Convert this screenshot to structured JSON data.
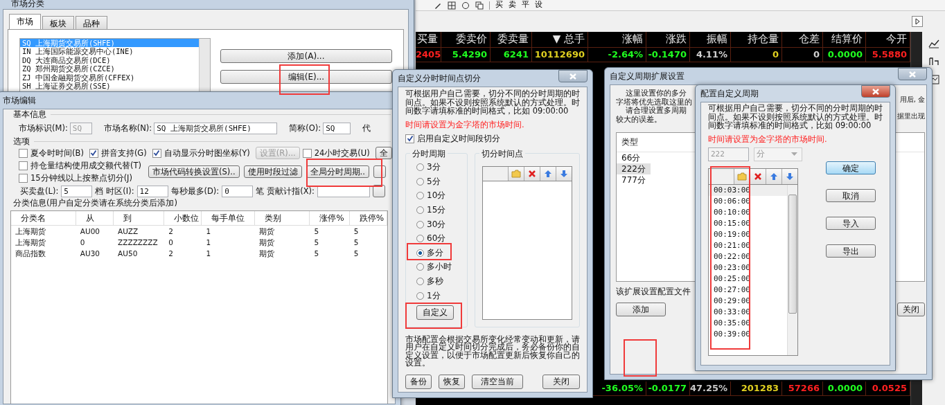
{
  "toolbar": {
    "buttons": [
      "买",
      "卖",
      "平",
      "设"
    ]
  },
  "quote_grid": {
    "columns": [
      "买量",
      "委卖价",
      "委卖量",
      "▼ 总手",
      "涨幅",
      "涨跌",
      "振幅",
      "持仓量",
      "仓差",
      "结算价",
      "今开"
    ],
    "rows": [
      {
        "cells": [
          {
            "text": "2405",
            "color": "#ff2020"
          },
          {
            "text": "5.4290",
            "color": "#20ff20"
          },
          {
            "text": "6241",
            "color": "#20ff20"
          },
          {
            "text": "10112690",
            "color": "#e0d020"
          },
          {
            "text": "-2.64%",
            "color": "#20ff20"
          },
          {
            "text": "-0.1470",
            "color": "#20ff20"
          },
          {
            "text": "4.11%",
            "color": "#d0d0d0"
          },
          {
            "text": "0",
            "color": "#e0d020"
          },
          {
            "text": "0",
            "color": "#d0d0d0"
          },
          {
            "text": "0.0000",
            "color": "#20ff20"
          },
          {
            "text": "5.5880",
            "color": "#ff2020"
          }
        ]
      },
      {
        "cells": [
          null,
          null,
          null,
          null,
          {
            "text": "-36.05%",
            "color": "#20ff20"
          },
          {
            "text": "-0.0177",
            "color": "#20ff20"
          },
          {
            "text": "47.25%",
            "color": "#c8c8c8"
          },
          {
            "text": "201283",
            "color": "#e0d020"
          },
          {
            "text": "57266",
            "color": "#ff2020"
          },
          {
            "text": "0.0000",
            "color": "#20ff20"
          },
          {
            "text": "0.0525",
            "color": "#ff2020"
          }
        ]
      }
    ]
  },
  "market_category_window": {
    "title": "市场分类",
    "tabs": [
      {
        "label": "市场",
        "selected": true
      },
      {
        "label": "板块",
        "selected": false
      },
      {
        "label": "品种",
        "selected": false
      }
    ],
    "markets": [
      {
        "text": "SQ 上海期货交易所(SHFE)",
        "selected": true
      },
      {
        "text": "IN 上海国际能源交易中心(INE)",
        "selected": false
      },
      {
        "text": "DQ 大连商品交易所(DCE)",
        "selected": false
      },
      {
        "text": "ZQ 郑州期货交易所(CZCE)",
        "selected": false
      },
      {
        "text": "ZJ 中国金融期货交易所(CFFEX)",
        "selected": false
      },
      {
        "text": "SH 上海证券交易所(SSE)",
        "selected": false
      }
    ],
    "buttons": [
      "添加(A)...",
      "编辑(E)..."
    ]
  },
  "market_edit_window": {
    "title": "市场编辑",
    "basic_legend": "基本信息",
    "fields": [
      {
        "label": "市场标识(M):",
        "value": "SQ",
        "disabled": true
      },
      {
        "label": "市场名称(N):",
        "value": "SQ 上海期货交易所(SHFE)",
        "disabled": false
      },
      {
        "label": "简称(O):",
        "value": "SQ",
        "disabled": false
      }
    ],
    "cut_label": "代",
    "options_legend": "选项",
    "option_row": [
      {
        "kind": "checkbox",
        "label": "夏令时时间(B)",
        "checked": false
      },
      {
        "kind": "checkbox",
        "label": "拼音支持(G)",
        "checked": true
      },
      {
        "kind": "checkbox",
        "label": "自动显示分时图坐标(Y)",
        "checked": true
      },
      {
        "kind": "button",
        "label": "设置(R)...",
        "disabled": true
      },
      {
        "kind": "checkbox",
        "label": "24小时交易(U)",
        "checked": false
      },
      {
        "kind": "button",
        "label": "全",
        "disabled": false
      }
    ],
    "left_checks": [
      {
        "label": "持仓量结构使用成交额代替(T)",
        "checked": false
      },
      {
        "label": "15分钟线以上按整点切分(J)",
        "checked": false
      }
    ],
    "buttons": [
      "市场代码转换设置(S)..",
      "使用时段过滤",
      "全局分时周期.."
    ],
    "number_row": [
      {
        "kind": "label",
        "text": "买卖盘(L):"
      },
      {
        "kind": "field",
        "value": "5"
      },
      {
        "kind": "label",
        "text": "档"
      },
      {
        "kind": "label",
        "text": "时区(I):"
      },
      {
        "kind": "field",
        "value": "12"
      },
      {
        "kind": "label",
        "text": "每秒最多(D):"
      },
      {
        "kind": "field",
        "value": "0"
      },
      {
        "kind": "label",
        "text": "笔"
      },
      {
        "kind": "label",
        "text": "贡献计指(X):"
      },
      {
        "kind": "field"
      }
    ],
    "category_legend": "分类信息(用户自定分类请在系统分类后添加)",
    "table": {
      "columns": [
        "分类名",
        "从",
        "到",
        "小数位",
        "每手单位",
        "类别",
        "涨停%",
        "跌停%"
      ],
      "rows": [
        [
          "上海期货",
          "AU00",
          "AUZZ",
          "2",
          "1",
          "期货",
          "5",
          "5"
        ],
        [
          "上海期货",
          "0",
          "ZZZZZZZZ",
          "0",
          "1",
          "期货",
          "5",
          "5"
        ],
        [
          "商品指数",
          "AU30",
          "AU50",
          "2",
          "1",
          "期货",
          "5",
          "5"
        ]
      ]
    }
  },
  "time_split_window": {
    "title": "自定义分时时间点切分",
    "intro": "可根据用户自己需要，切分不同的分时周期的时间点。如果不设则按照系统默认的方式处理。时间数字请填标准的时间格式，比如 09:00:00",
    "warning": "时间请设置为金字塔的市场时间.",
    "enable": {
      "label": "启用自定义时间段切分",
      "checked": true
    },
    "period_legend": "分时周期",
    "periods": [
      {
        "label": "3分",
        "selected": false
      },
      {
        "label": "5分",
        "selected": false
      },
      {
        "label": "10分",
        "selected": false
      },
      {
        "label": "15分",
        "selected": false
      },
      {
        "label": "30分",
        "selected": false
      },
      {
        "label": "60分",
        "selected": false
      },
      {
        "label": "多分",
        "selected": true
      },
      {
        "label": "多小时",
        "selected": false
      },
      {
        "label": "多秒",
        "selected": false
      },
      {
        "label": "1分",
        "selected": false
      }
    ],
    "custom_button": "自定义",
    "points_legend": "切分时间点",
    "note": "市场配置会根据交易所变化经常变动和更新，请用户在自定义时间切分完成后，务必备份你的自定义设置，以便于市场配置更新后恢复你自己的设置。",
    "buttons": [
      "备份",
      "恢复",
      "清空当前",
      "关闭"
    ]
  },
  "period_ext_window": {
    "title": "自定义周期扩展设置",
    "intro_left": [
      "这里设置你的多分",
      "字塔将优先选取这里的",
      "请合理设置多周期",
      "较大的误差。"
    ],
    "intro_right": [
      "用后, 金",
      "据里出现"
    ],
    "list_header": "类型",
    "types": [
      {
        "label": "66分",
        "selected": false
      },
      {
        "label": "222分",
        "selected": true
      },
      {
        "label": "777分",
        "selected": false
      }
    ],
    "note": "该扩展设置配置文件",
    "buttons": [
      "添加",
      "关闭"
    ]
  },
  "config_period_window": {
    "title": "配置自定义周期",
    "intro": "可根据用户自己需要，切分不同的分时周期的时间点。如果不设则按照系统默认的方式处理。时间数字请填标准的时间格式，比如 09:00:00",
    "warning": "时间请设置为金字塔的市场时间.",
    "value": "222",
    "unit": "分",
    "times": [
      {
        "text": "00:03:00",
        "selected": true
      },
      {
        "text": "00:06:00",
        "selected": false
      },
      {
        "text": "00:10:00",
        "selected": false
      },
      {
        "text": "00:15:00",
        "selected": false
      },
      {
        "text": "00:19:00",
        "selected": false
      },
      {
        "text": "00:21:00",
        "selected": false
      },
      {
        "text": "00:22:00",
        "selected": false
      },
      {
        "text": "00:23:00",
        "selected": false
      },
      {
        "text": "00:25:00",
        "selected": false
      },
      {
        "text": "00:27:00",
        "selected": false
      },
      {
        "text": "00:29:00",
        "selected": false
      },
      {
        "text": "00:33:00",
        "selected": false
      },
      {
        "text": "00:35:00",
        "selected": false
      },
      {
        "text": "00:39:00",
        "selected": false
      }
    ],
    "buttons": [
      {
        "label": "确定",
        "default": true
      },
      {
        "label": "取消",
        "default": false
      },
      {
        "label": "导入",
        "default": false
      },
      {
        "label": "导出",
        "default": false
      }
    ]
  }
}
